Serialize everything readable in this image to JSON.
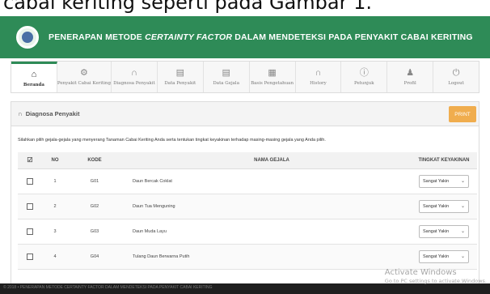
{
  "caption": "cabai keriting seperti pada Gambar 1.",
  "header": {
    "title_prefix": "PENERAPAN METODE ",
    "title_emphasis": "CERTAINTY FACTOR",
    "title_suffix": " DALAM MENDETEKSI PADA PENYAKIT CABAI KERITING"
  },
  "nav": {
    "items": [
      {
        "label": "Beranda",
        "icon": "home-icon"
      },
      {
        "label": "Penyakit Cabai Keriting",
        "icon": "gears-icon"
      },
      {
        "label": "Diagnosa Penyakit",
        "icon": "stethoscope-icon"
      },
      {
        "label": "Data Penyakit",
        "icon": "list-icon"
      },
      {
        "label": "Data Gejala",
        "icon": "list-icon"
      },
      {
        "label": "Basis Pengetahuan",
        "icon": "grid-icon"
      },
      {
        "label": "History",
        "icon": "stethoscope-icon"
      },
      {
        "label": "Petunjuk",
        "icon": "info-icon"
      },
      {
        "label": "Profil",
        "icon": "user-icon"
      },
      {
        "label": "Logout",
        "icon": "power-icon"
      }
    ]
  },
  "panel": {
    "title": "Diagnosa Penyakit",
    "print_label": "PRINT",
    "instruction": "Silahkan pilih gejala-gejala yang menyerang Tanaman Cabai Keriting Anda serta tentukan tingkat keyakinan terhadap masing-masing gejala yang Anda pilih."
  },
  "table": {
    "headers": {
      "check": "☑",
      "no": "NO",
      "kode": "KODE",
      "nama": "NAMA GEJALA",
      "tingkat": "TINGKAT KEYAKINAN"
    },
    "rows": [
      {
        "no": "1",
        "kode": "G01",
        "nama": "Daun Bercak Coklat",
        "tingkat": "Sangat Yakin"
      },
      {
        "no": "2",
        "kode": "G02",
        "nama": "Daun Tua Menguning",
        "tingkat": "Sangat Yakin"
      },
      {
        "no": "3",
        "kode": "G03",
        "nama": "Daun Muda Layu",
        "tingkat": "Sangat Yakin"
      },
      {
        "no": "4",
        "kode": "G04",
        "nama": "Tulang Daun Berwarna Putih",
        "tingkat": "Sangat Yakin"
      }
    ]
  },
  "footer": {
    "text": "© 2018 • PENERAPAN METODE CERTAINTY FACTOR DALAM MENDETEKSI PADA PENYAKIT CABAI KERITING"
  },
  "watermark": {
    "title": "Activate Windows",
    "subtitle": "Go to PC settings to activate Windows."
  },
  "colors": {
    "header": "#2e8b57",
    "print_button": "#f0ad4e",
    "footer": "#1f1f1f"
  }
}
